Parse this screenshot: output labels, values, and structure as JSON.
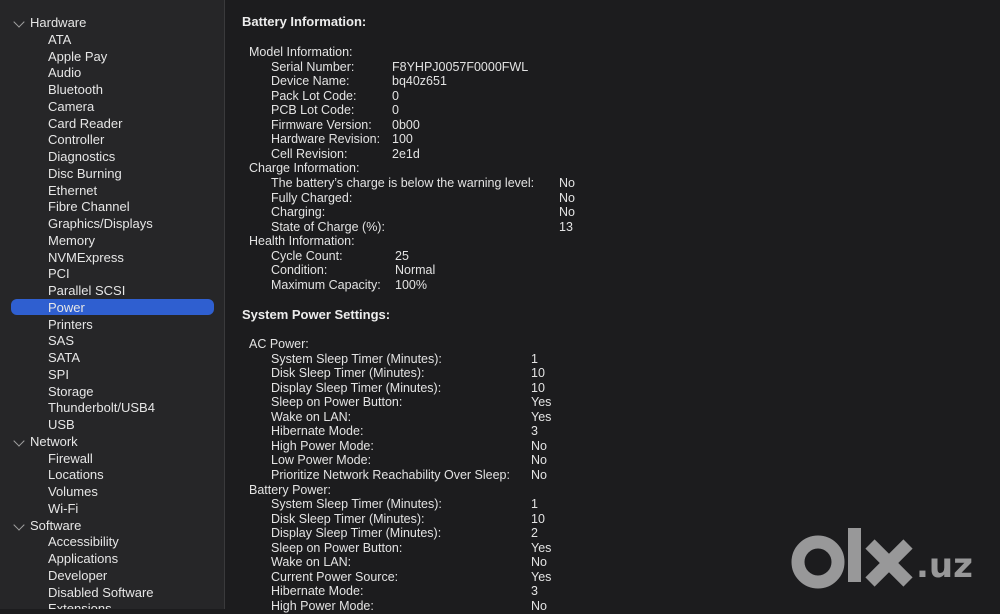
{
  "sidebar": {
    "sections": [
      {
        "label": "Hardware",
        "items": [
          "ATA",
          "Apple Pay",
          "Audio",
          "Bluetooth",
          "Camera",
          "Card Reader",
          "Controller",
          "Diagnostics",
          "Disc Burning",
          "Ethernet",
          "Fibre Channel",
          "Graphics/Displays",
          "Memory",
          "NVMExpress",
          "PCI",
          "Parallel SCSI",
          "Power",
          "Printers",
          "SAS",
          "SATA",
          "SPI",
          "Storage",
          "Thunderbolt/USB4",
          "USB"
        ]
      },
      {
        "label": "Network",
        "items": [
          "Firewall",
          "Locations",
          "Volumes",
          "Wi-Fi"
        ]
      },
      {
        "label": "Software",
        "items": [
          "Accessibility",
          "Applications",
          "Developer",
          "Disabled Software",
          "Extensions"
        ]
      }
    ],
    "selected": "Power"
  },
  "battery": {
    "heading": "Battery Information:",
    "model": {
      "label": "Model Information:",
      "rows": [
        {
          "k": "Serial Number:",
          "v": "F8YHPJ0057F0000FWL"
        },
        {
          "k": "Device Name:",
          "v": "bq40z651"
        },
        {
          "k": "Pack Lot Code:",
          "v": "0"
        },
        {
          "k": "PCB Lot Code:",
          "v": "0"
        },
        {
          "k": "Firmware Version:",
          "v": "0b00"
        },
        {
          "k": "Hardware Revision:",
          "v": "100"
        },
        {
          "k": "Cell Revision:",
          "v": "2e1d"
        }
      ]
    },
    "charge": {
      "label": "Charge Information:",
      "rows": [
        {
          "k": "The battery’s charge is below the warning level:",
          "v": "No"
        },
        {
          "k": "Fully Charged:",
          "v": "No"
        },
        {
          "k": "Charging:",
          "v": "No"
        },
        {
          "k": "State of Charge (%):",
          "v": "13"
        }
      ]
    },
    "health": {
      "label": "Health Information:",
      "rows": [
        {
          "k": "Cycle Count:",
          "v": "25"
        },
        {
          "k": "Condition:",
          "v": "Normal"
        },
        {
          "k": "Maximum Capacity:",
          "v": "100%"
        }
      ]
    }
  },
  "power": {
    "heading": "System Power Settings:",
    "ac": {
      "label": "AC Power:",
      "rows": [
        {
          "k": "System Sleep Timer (Minutes):",
          "v": "1"
        },
        {
          "k": "Disk Sleep Timer (Minutes):",
          "v": "10"
        },
        {
          "k": "Display Sleep Timer (Minutes):",
          "v": "10"
        },
        {
          "k": "Sleep on Power Button:",
          "v": "Yes"
        },
        {
          "k": "Wake on LAN:",
          "v": "Yes"
        },
        {
          "k": "Hibernate Mode:",
          "v": "3"
        },
        {
          "k": "High Power Mode:",
          "v": "No"
        },
        {
          "k": "Low Power Mode:",
          "v": "No"
        },
        {
          "k": "Prioritize Network Reachability Over Sleep:",
          "v": "No"
        }
      ]
    },
    "battery": {
      "label": "Battery Power:",
      "rows": [
        {
          "k": "System Sleep Timer (Minutes):",
          "v": "1"
        },
        {
          "k": "Disk Sleep Timer (Minutes):",
          "v": "10"
        },
        {
          "k": "Display Sleep Timer (Minutes):",
          "v": "2"
        },
        {
          "k": "Sleep on Power Button:",
          "v": "Yes"
        },
        {
          "k": "Wake on LAN:",
          "v": "No"
        },
        {
          "k": "Current Power Source:",
          "v": "Yes"
        },
        {
          "k": "Hibernate Mode:",
          "v": "3"
        },
        {
          "k": "High Power Mode:",
          "v": "No"
        }
      ]
    }
  },
  "watermark": {
    "text": ".uz",
    "logo": "olx-logo"
  }
}
